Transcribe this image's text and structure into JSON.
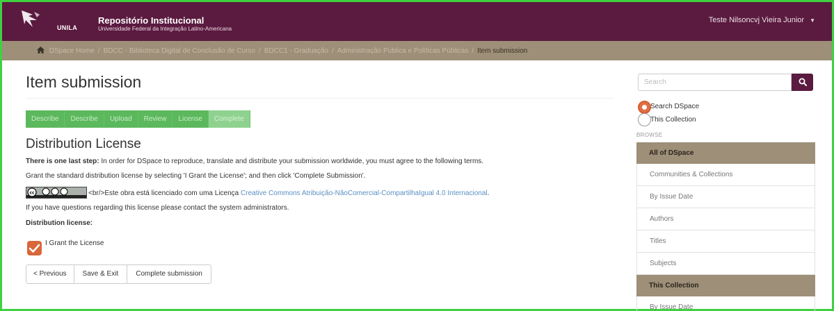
{
  "header": {
    "logo_text": "UNILA",
    "title": "Repositório Institucional",
    "subtitle": "Universidade Federal da Integração Latino-Americana",
    "user": "Teste Nilsoncvj Vieira Junior",
    "user_caret_icon": "caret-down-icon"
  },
  "breadcrumb": {
    "home_icon": "home-icon",
    "items": [
      "DSpace Home",
      "BDCC - Biblioteca Digital de Conclusão de Curso",
      "BDCC1 - Graduação",
      "Administração Pública e Políticas Públicas"
    ],
    "separator": "/",
    "current": "Item submission"
  },
  "main": {
    "title": "Item submission",
    "steps": [
      "Describe",
      "Describe",
      "Upload",
      "Review",
      "License",
      "Complete"
    ],
    "active_step": "Complete",
    "section_title": "Distribution License",
    "intro_strong": "There is one last step:",
    "intro_rest": " In order for DSpace to reproduce, translate and distribute your submission worldwide, you must agree to the following terms.",
    "grant_text": "Grant the standard distribution license by selecting 'I Grant the License'; and then click 'Complete Submission'.",
    "cc_text": "<br/>Este obra está licenciado com uma Licença ",
    "cc_link": "Creative Commons Atribuição-NãoComercial-CompartilhaIgual 4.0 Internacional",
    "cc_tail": ".",
    "contact_text": "If you have questions regarding this license please contact the system administrators.",
    "license_label": "Distribution license:",
    "grant_label": "I Grant the License",
    "grant_checked": true,
    "buttons": {
      "previous": "< Previous",
      "save": "Save & Exit",
      "complete": "Complete submission"
    }
  },
  "sidebar": {
    "search_placeholder": "Search",
    "search_icon": "search-icon",
    "scope_options": [
      "Search DSpace",
      "This Collection"
    ],
    "scope_selected": "Search DSpace",
    "browse_label": "BROWSE",
    "all_heading": "All of DSpace",
    "all_items": [
      "Communities & Collections",
      "By Issue Date",
      "Authors",
      "Titles",
      "Subjects"
    ],
    "collection_heading": "This Collection",
    "collection_items": [
      "By Issue Date"
    ]
  },
  "colors": {
    "header_bg": "#5b1a3f",
    "breadcrumb_bg": "#9d8f78",
    "step_bg": "#5cb85c",
    "checkbox": "#d9673a",
    "frame": "#3fd13f"
  }
}
